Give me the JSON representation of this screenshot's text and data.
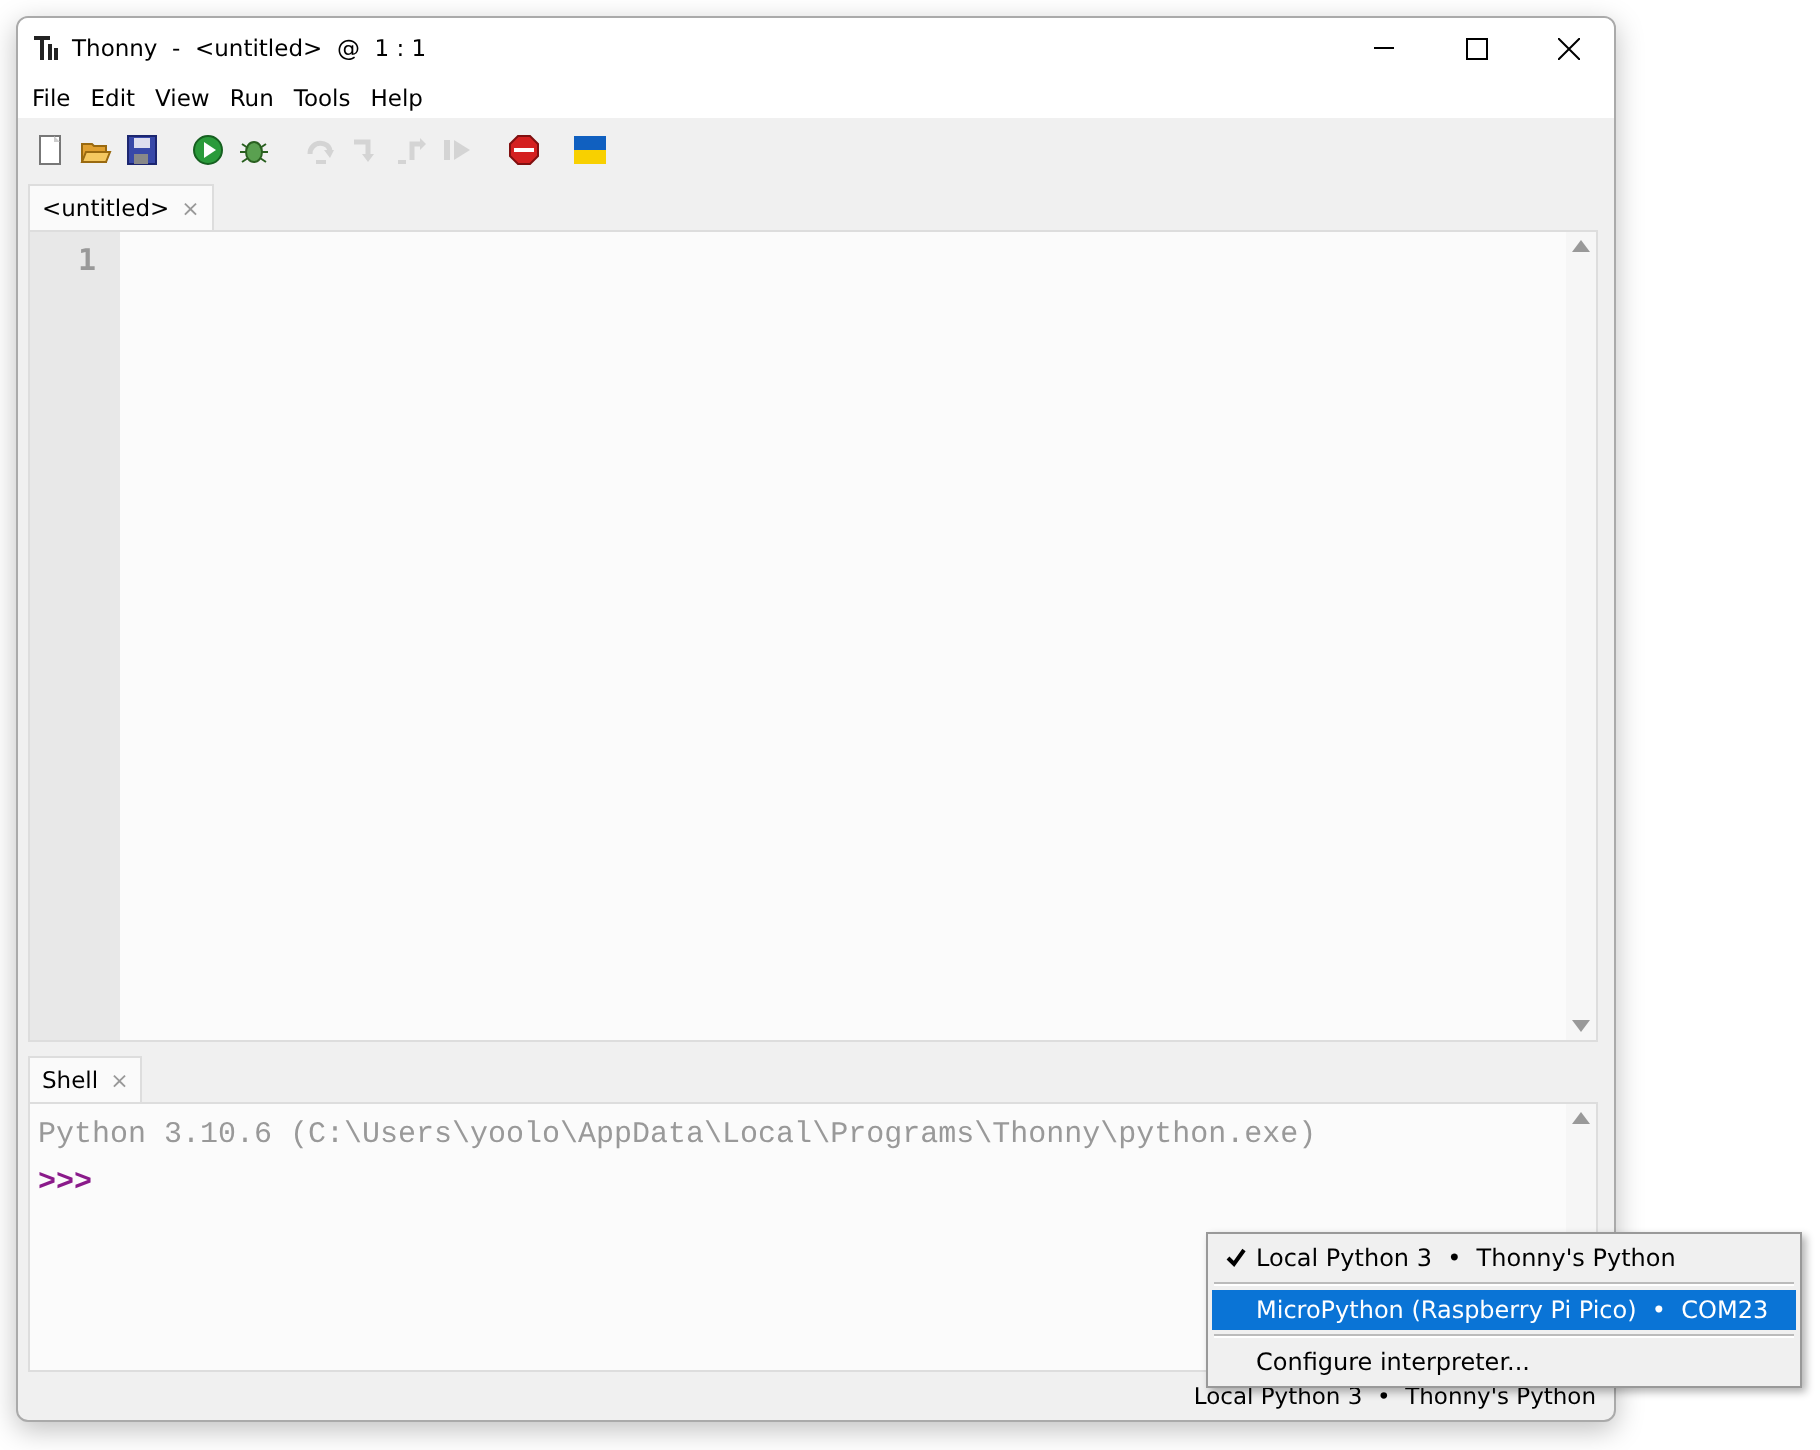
{
  "window": {
    "title": "Thonny  -  <untitled>  @  1 : 1"
  },
  "menu": [
    "File",
    "Edit",
    "View",
    "Run",
    "Tools",
    "Help"
  ],
  "toolbar": [
    {
      "disabled": false
    },
    {
      "disabled": false
    },
    {
      "disabled": false
    },
    {
      "disabled": false
    },
    {
      "disabled": false
    },
    {
      "disabled": true
    },
    {
      "disabled": true
    },
    {
      "disabled": true
    },
    {
      "disabled": true
    },
    {
      "disabled": false
    },
    {
      "disabled": false
    }
  ],
  "editor": {
    "tabs": [
      {
        "label": "<untitled>",
        "close": "×",
        "selected": true
      }
    ],
    "line_numbers": [
      "1"
    ]
  },
  "shell": {
    "tabs": [
      {
        "label": "Shell",
        "close": "×",
        "selected": true
      }
    ],
    "lines": [
      {
        "kind": "output",
        "text": "Python 3.10.6 (C:\\Users\\yoolo\\AppData\\Local\\Programs\\Thonny\\python.exe)"
      },
      {
        "kind": "prompt",
        "text": ">>>"
      }
    ]
  },
  "interpreter_menu": [
    {
      "label": "Local Python 3  •  Thonny's Python",
      "checked": true,
      "selected": false
    },
    {
      "label": "MicroPython (Raspberry Pi Pico)  •  COM23",
      "checked": false,
      "selected": true
    },
    {
      "label": "Configure interpreter...",
      "checked": false,
      "selected": false
    }
  ],
  "status_bar": {
    "interpreter": "Local Python 3  •  Thonny's Python"
  }
}
